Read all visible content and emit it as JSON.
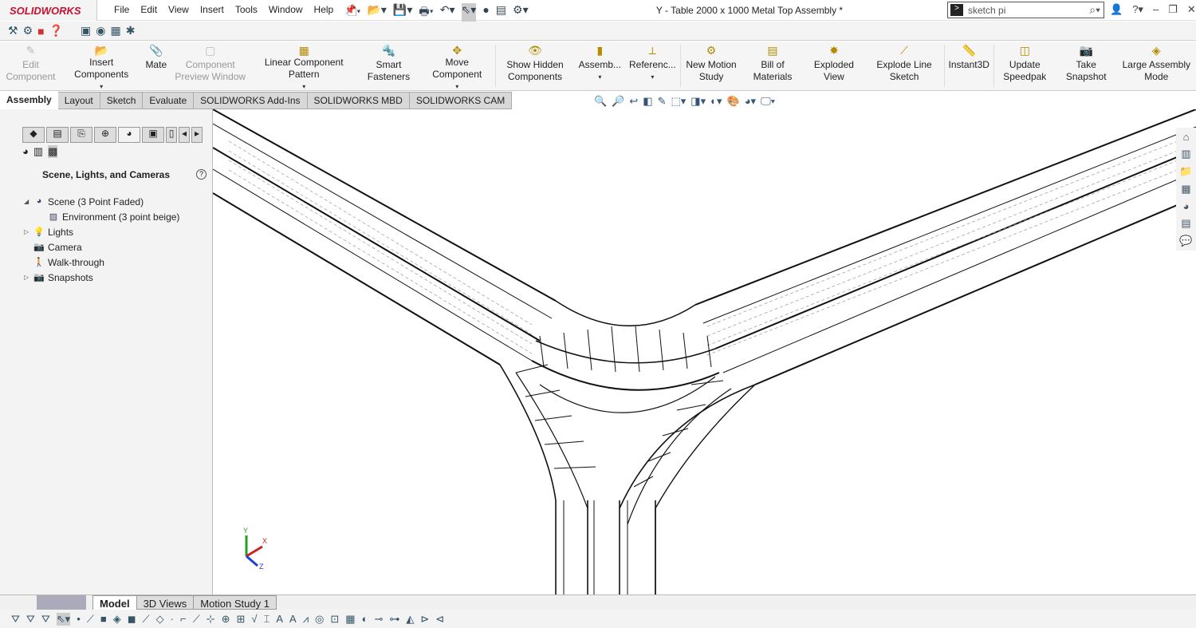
{
  "app": {
    "logo": "SOLIDWORKS",
    "title": "Y - Table 2000 x 1000 Metal Top Assembly *"
  },
  "menu": [
    "File",
    "Edit",
    "View",
    "Insert",
    "Tools",
    "Window",
    "Help"
  ],
  "search": {
    "value": "sketch pi"
  },
  "command_manager": [
    {
      "label": "Edit Component",
      "icon": "edit-component-icon",
      "disabled": true
    },
    {
      "label": "Insert Components",
      "icon": "insert-components-icon",
      "dropdown": true
    },
    {
      "label": "Mate",
      "icon": "paperclip-icon"
    },
    {
      "label": "Component Preview Window",
      "icon": "preview-window-icon",
      "disabled": true
    },
    {
      "label": "Linear Component Pattern",
      "icon": "pattern-icon",
      "dropdown": true
    },
    {
      "label": "Smart Fasteners",
      "icon": "fasteners-icon"
    },
    {
      "label": "Move Component",
      "icon": "move-icon",
      "dropdown": true
    },
    {
      "label": "Show Hidden Components",
      "icon": "show-hidden-icon"
    },
    {
      "label": "Assemb...",
      "icon": "assembly-icon",
      "dropdown": true
    },
    {
      "label": "Referenc...",
      "icon": "reference-icon",
      "dropdown": true
    },
    {
      "label": "New Motion Study",
      "icon": "motion-study-icon"
    },
    {
      "label": "Bill of Materials",
      "icon": "bom-icon"
    },
    {
      "label": "Exploded View",
      "icon": "exploded-view-icon"
    },
    {
      "label": "Explode Line Sketch",
      "icon": "explode-line-icon"
    },
    {
      "label": "Instant3D",
      "icon": "instant3d-icon"
    },
    {
      "label": "Update Speedpak",
      "icon": "speedpak-icon"
    },
    {
      "label": "Take Snapshot",
      "icon": "camera-icon"
    },
    {
      "label": "Large Assembly Mode",
      "icon": "large-assembly-icon"
    }
  ],
  "tabs": [
    "Assembly",
    "Layout",
    "Sketch",
    "Evaluate",
    "SOLIDWORKS Add-Ins",
    "SOLIDWORKS MBD",
    "SOLIDWORKS CAM"
  ],
  "panel": {
    "title": "Scene, Lights, and Cameras",
    "tree": [
      {
        "label": "Scene (3 Point Faded)",
        "level": 0,
        "expander": "expanded"
      },
      {
        "label": "Environment (3 point beige)",
        "level": 1
      },
      {
        "label": "Lights",
        "level": 0,
        "expander": "collapsed"
      },
      {
        "label": "Camera",
        "level": 0
      },
      {
        "label": "Walk-through",
        "level": 0
      },
      {
        "label": "Snapshots",
        "level": 0,
        "expander": "collapsed"
      }
    ]
  },
  "bottom_tabs": [
    "Model",
    "3D Views",
    "Motion Study 1"
  ],
  "triad": {
    "x": "X",
    "y": "Y",
    "z": "Z"
  },
  "colors": {
    "brand": "#c8102e",
    "x_axis": "#d02020",
    "y_axis": "#20a020",
    "z_axis": "#2040d0"
  }
}
